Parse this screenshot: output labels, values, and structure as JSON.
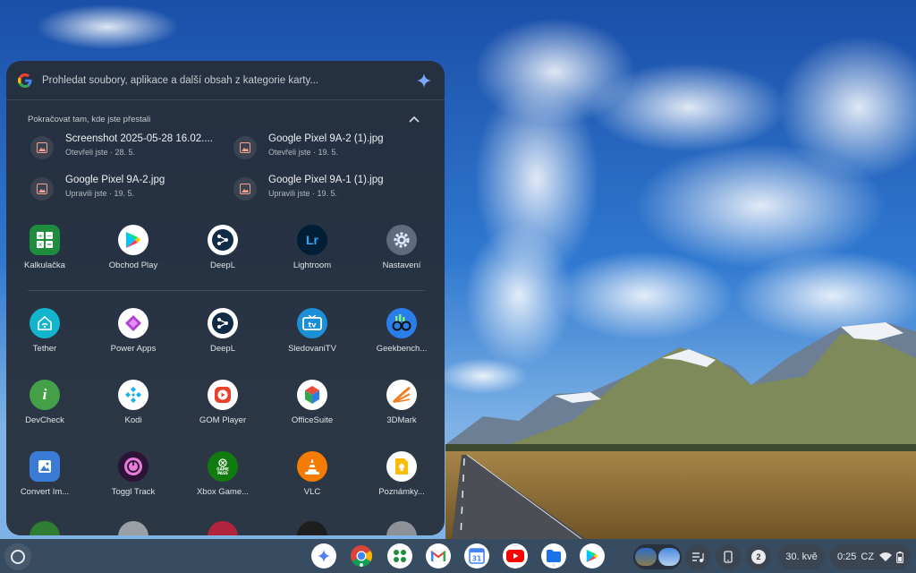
{
  "search": {
    "placeholder": "Prohledat soubory, aplikace a další obsah z kategorie karty..."
  },
  "continue_section": {
    "title": "Pokračovat tam, kde jste přestali",
    "items": [
      {
        "name": "Screenshot 2025-05-28 16.02....",
        "meta": "Otevřeli jste · 28. 5."
      },
      {
        "name": "Google Pixel 9A-2 (1).jpg",
        "meta": "Otevřeli jste · 19. 5."
      },
      {
        "name": "Google Pixel 9A-2.jpg",
        "meta": "Upravili jste · 19. 5."
      },
      {
        "name": "Google Pixel 9A-1 (1).jpg",
        "meta": "Upravili jste · 19. 5."
      }
    ]
  },
  "pinned_apps": [
    {
      "label": "Kalkulačka",
      "icon": "calculator-icon",
      "color": "#1e8e3e"
    },
    {
      "label": "Obchod Play",
      "icon": "play-store-icon",
      "color": "#ffffff"
    },
    {
      "label": "DeepL",
      "icon": "deepl-icon",
      "color": "#ffffff"
    },
    {
      "label": "Lightroom",
      "icon": "lightroom-icon",
      "color": "#001e36"
    },
    {
      "label": "Nastavení",
      "icon": "settings-icon",
      "color": "#5f6b7a"
    }
  ],
  "apps": [
    {
      "label": "Tether",
      "icon": "tether-icon",
      "color": "#12b5cb"
    },
    {
      "label": "Power Apps",
      "icon": "power-apps-icon",
      "color": "#ffffff"
    },
    {
      "label": "DeepL",
      "icon": "deepl-icon",
      "color": "#ffffff"
    },
    {
      "label": "SledovaniTV",
      "icon": "sledovanitv-icon",
      "color": "#1c8fd6"
    },
    {
      "label": "Geekbench...",
      "icon": "geekbench-icon",
      "color": "#2b7de9"
    },
    {
      "label": "DevCheck",
      "icon": "devcheck-icon",
      "color": "#43a047"
    },
    {
      "label": "Kodi",
      "icon": "kodi-icon",
      "color": "#ffffff"
    },
    {
      "label": "GOM Player",
      "icon": "gom-player-icon",
      "color": "#ffffff"
    },
    {
      "label": "OfficeSuite",
      "icon": "officesuite-icon",
      "color": "#ffffff"
    },
    {
      "label": "3DMark",
      "icon": "3dmark-icon",
      "color": "#ffffff"
    },
    {
      "label": "Convert Im...",
      "icon": "convert-image-icon",
      "color": "#3a7bd5"
    },
    {
      "label": "Toggl Track",
      "icon": "toggl-track-icon",
      "color": "#2c1338"
    },
    {
      "label": "Xbox Game...",
      "icon": "xbox-game-pass-icon",
      "color": "#107c10"
    },
    {
      "label": "VLC",
      "icon": "vlc-icon",
      "color": "#f57c00"
    },
    {
      "label": "Poznámky...",
      "icon": "notes-icon",
      "color": "#ffffff"
    }
  ],
  "shelf": {
    "apps": [
      {
        "name": "gemini-icon"
      },
      {
        "name": "chrome-icon"
      },
      {
        "name": "app-grid-icon"
      },
      {
        "name": "gmail-icon"
      },
      {
        "name": "calendar-icon",
        "text": "31"
      },
      {
        "name": "youtube-icon"
      },
      {
        "name": "files-icon"
      },
      {
        "name": "play-store-icon"
      }
    ],
    "notification_count": "2",
    "date": "30. kvě",
    "time": "0:25",
    "keyboard_layout": "CZ"
  }
}
